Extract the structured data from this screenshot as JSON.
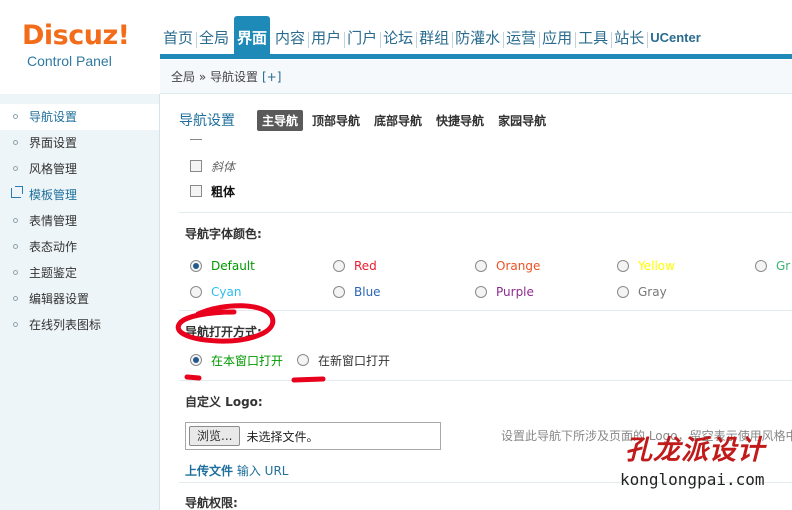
{
  "logo": {
    "main": "Discuz!",
    "sub": "Control Panel"
  },
  "nav": {
    "items": [
      "首页",
      "全局",
      "界面",
      "内容",
      "用户",
      "门户",
      "论坛",
      "群组",
      "防灌水",
      "运营",
      "应用",
      "工具",
      "站长",
      "UCenter"
    ],
    "active": "界面"
  },
  "breadcrumb": {
    "path": "全局 » 导航设置",
    "add": "[+]"
  },
  "sidebar": {
    "items": [
      {
        "label": "导航设置"
      },
      {
        "label": "界面设置"
      },
      {
        "label": "风格管理"
      },
      {
        "label": "模板管理"
      },
      {
        "label": "表情管理"
      },
      {
        "label": "表态动作"
      },
      {
        "label": "主题鉴定"
      },
      {
        "label": "编辑器设置"
      },
      {
        "label": "在线列表图标"
      }
    ]
  },
  "main": {
    "title": "导航设置",
    "tabs": [
      "主导航",
      "顶部导航",
      "底部导航",
      "快捷导航",
      "家园导航"
    ],
    "active_tab": "主导航",
    "style_options": [
      {
        "label": "斜体",
        "checked": false
      },
      {
        "label": "粗体",
        "checked": false
      }
    ],
    "color_label": "导航字体颜色:",
    "colors": [
      {
        "label": "Default",
        "color": "#009900",
        "checked": true
      },
      {
        "label": "Red",
        "color": "#ee1b2e",
        "checked": false
      },
      {
        "label": "Orange",
        "color": "#ee5023",
        "checked": false
      },
      {
        "label": "Yellow",
        "color": "#ffff00",
        "checked": false
      },
      {
        "label": "Gr",
        "color": "#3cb371",
        "checked": false
      },
      {
        "label": "Cyan",
        "color": "#2bbeee",
        "checked": false
      },
      {
        "label": "Blue",
        "color": "#2b65b7",
        "checked": false
      },
      {
        "label": "Purple",
        "color": "#8f2a90",
        "checked": false
      },
      {
        "label": "Gray",
        "color": "#777777",
        "checked": false
      }
    ],
    "open_label": "导航打开方式:",
    "open_options": [
      {
        "label": "在本窗口打开",
        "checked": true
      },
      {
        "label": "在新窗口打开",
        "checked": false
      }
    ],
    "logo_label": "自定义 Logo:",
    "browse_button": "浏览...",
    "file_status": "未选择文件。",
    "logo_tip": "设置此导航下所涉及页面的 Logo，留空表示使用风格中的 Logo",
    "upload_file": "上传文件",
    "input_url": "输入 URL",
    "perm_label": "导航权限:"
  },
  "watermark": {
    "cn": "孔龙派设计",
    "en": "konglongpai.com"
  },
  "accent": "#1e8ab8"
}
